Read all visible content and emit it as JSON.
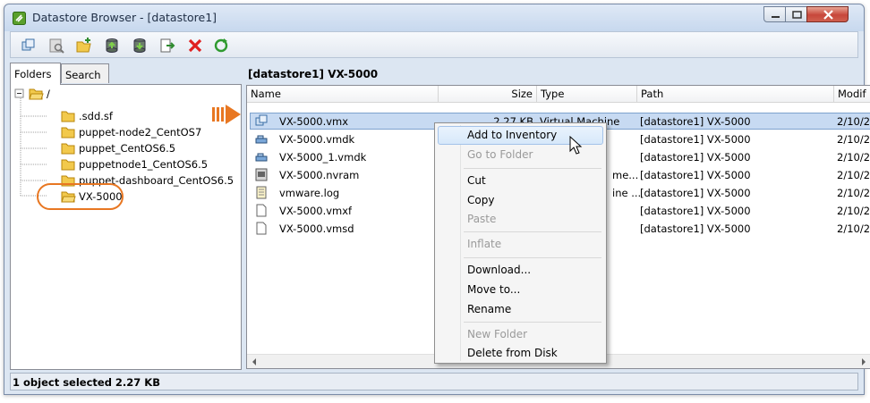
{
  "window": {
    "title": "Datastore Browser - [datastore1]"
  },
  "toolbar": {
    "buttons": [
      {
        "name": "browse-icon"
      },
      {
        "name": "search-datastore-icon"
      },
      {
        "name": "new-folder-icon"
      },
      {
        "name": "upload-icon"
      },
      {
        "name": "download-icon"
      },
      {
        "name": "move-icon"
      },
      {
        "name": "delete-icon"
      },
      {
        "name": "refresh-icon"
      }
    ]
  },
  "left_pane": {
    "tabs": [
      {
        "label": "Folders",
        "active": true
      },
      {
        "label": "Search",
        "active": false
      }
    ],
    "tree": {
      "root": "/",
      "children": [
        ".sdd.sf",
        "puppet-node2_CentOS7",
        "puppet_CentOS6.5",
        "puppetnode1_CentOS6.5",
        "puppet-dashboard_CentOS6.5",
        "VX-5000"
      ],
      "selected": "VX-5000"
    }
  },
  "right_pane": {
    "path": "[datastore1] VX-5000",
    "columns": [
      "Name",
      "Size",
      "Type",
      "Path",
      "Modif"
    ],
    "rows": [
      {
        "name": "VX-5000.vmx",
        "size": "2.27 KB",
        "type": "Virtual Machine",
        "path": "[datastore1] VX-5000",
        "modified": "2/10/2",
        "icon": "vm-file-icon",
        "selected": true
      },
      {
        "name": "VX-5000.vmdk",
        "size": "",
        "type": "",
        "path": "[datastore1] VX-5000",
        "modified": "2/10/2",
        "icon": "disk-file-icon"
      },
      {
        "name": "VX-5000_1.vmdk",
        "size": "",
        "type": "",
        "path": "[datastore1] VX-5000",
        "modified": "2/10/2",
        "icon": "disk-file-icon"
      },
      {
        "name": "VX-5000.nvram",
        "size": "",
        "type": "me...",
        "path": "[datastore1] VX-5000",
        "modified": "2/10/2",
        "icon": "nvram-file-icon"
      },
      {
        "name": "vmware.log",
        "size": "",
        "type": "ine ...",
        "path": "[datastore1] VX-5000",
        "modified": "2/10/2",
        "icon": "log-file-icon"
      },
      {
        "name": "VX-5000.vmxf",
        "size": "",
        "type": "",
        "path": "[datastore1] VX-5000",
        "modified": "2/10/2",
        "icon": "file-icon"
      },
      {
        "name": "VX-5000.vmsd",
        "size": "",
        "type": "",
        "path": "[datastore1] VX-5000",
        "modified": "2/10/2",
        "icon": "file-icon"
      }
    ]
  },
  "context_menu": {
    "items": [
      {
        "label": "Add to Inventory",
        "enabled": true,
        "highlighted": true
      },
      {
        "label": "Go to Folder",
        "enabled": false
      },
      {
        "label": "Cut",
        "enabled": true
      },
      {
        "label": "Copy",
        "enabled": true
      },
      {
        "label": "Paste",
        "enabled": false
      },
      {
        "label": "Inflate",
        "enabled": false
      },
      {
        "label": "Download...",
        "enabled": true
      },
      {
        "label": "Move to...",
        "enabled": true
      },
      {
        "label": "Rename",
        "enabled": true
      },
      {
        "label": "New Folder",
        "enabled": false
      },
      {
        "label": "Delete from Disk",
        "enabled": true
      }
    ]
  },
  "status": {
    "text": "1 object selected 2.27 KB"
  },
  "colors": {
    "accent_callout": "#e87722",
    "selection": "#c7daf2"
  }
}
